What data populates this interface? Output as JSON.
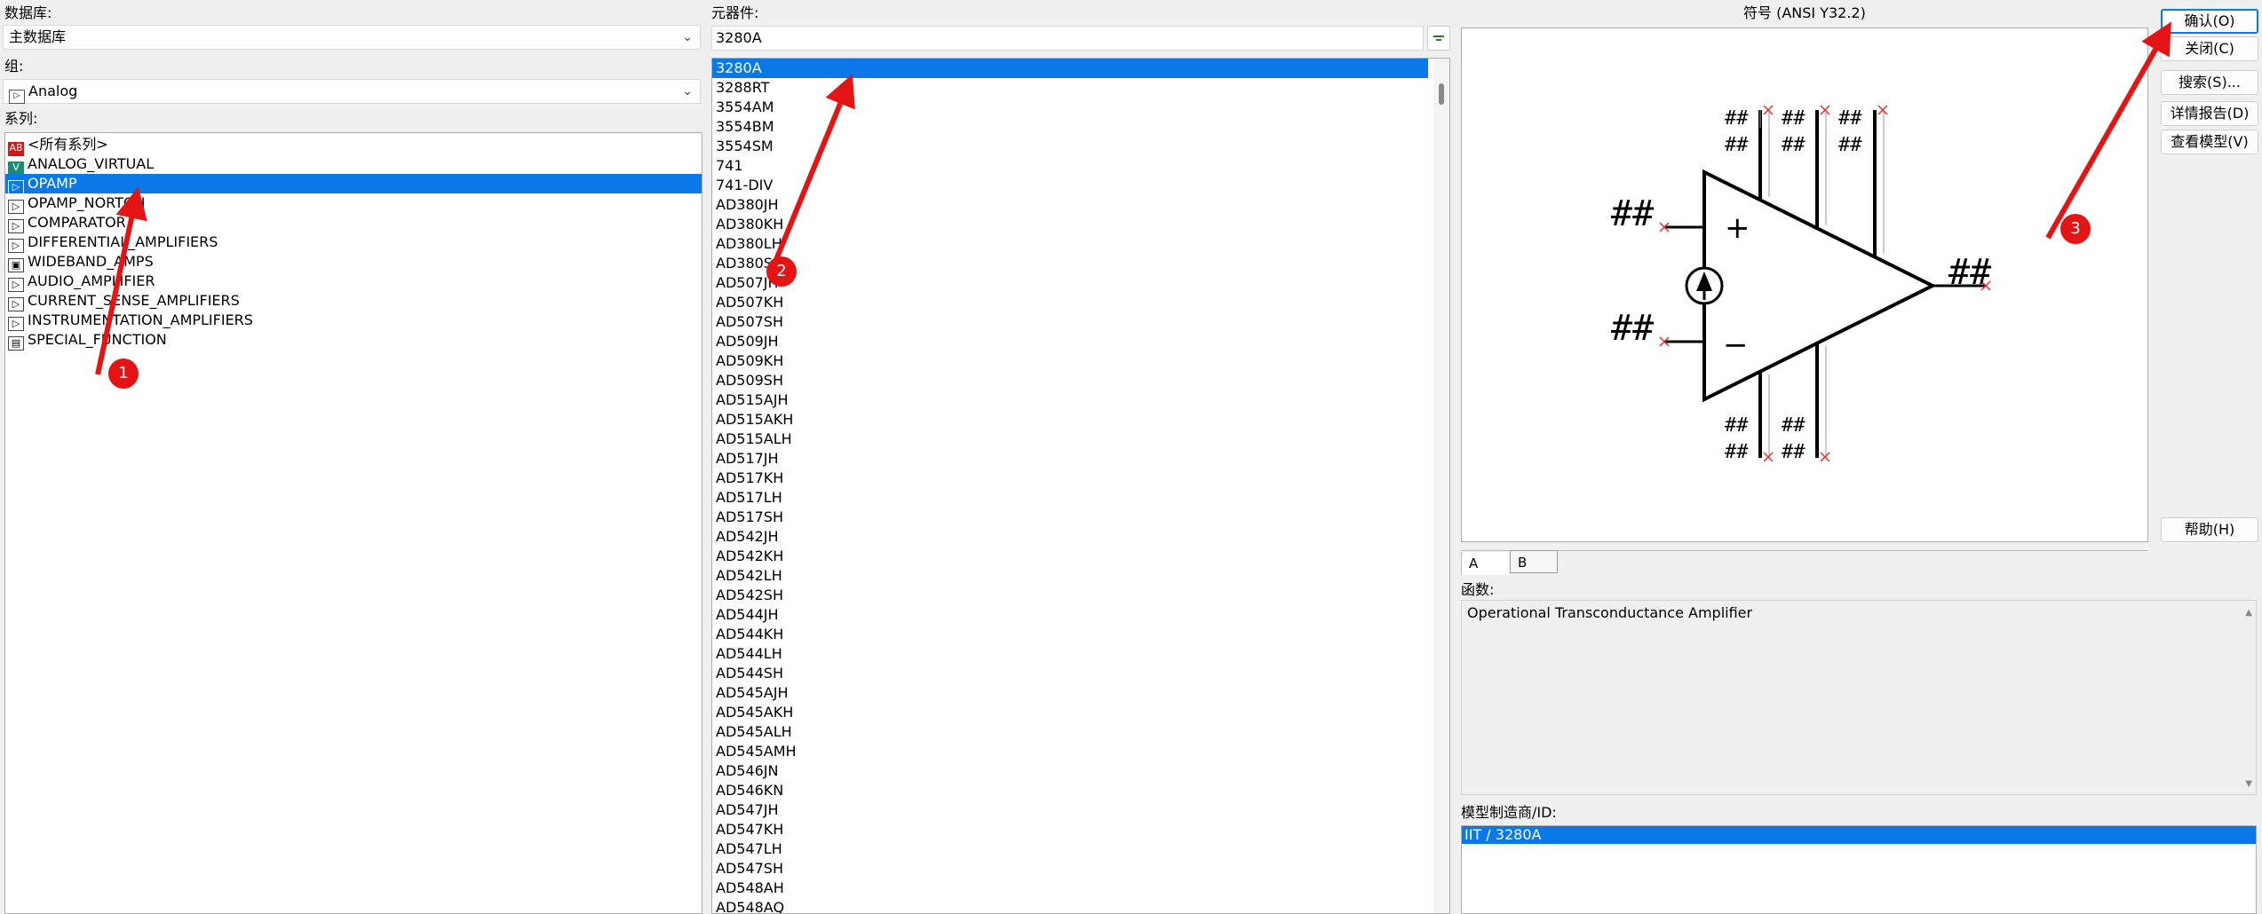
{
  "database": {
    "label": "数据库:",
    "value": "主数据库"
  },
  "group": {
    "label": "组:",
    "value": "Analog"
  },
  "family": {
    "label": "系列:",
    "items": [
      {
        "label": "<所有系列>",
        "icon": "all-families-icon",
        "selected": false
      },
      {
        "label": "ANALOG_VIRTUAL",
        "icon": "virtual-component-icon",
        "selected": false
      },
      {
        "label": "OPAMP",
        "icon": "opamp-icon",
        "selected": true
      },
      {
        "label": "OPAMP_NORTON",
        "icon": "opamp-norton-icon",
        "selected": false
      },
      {
        "label": "COMPARATOR",
        "icon": "comparator-icon",
        "selected": false
      },
      {
        "label": "DIFFERENTIAL_AMPLIFIERS",
        "icon": "differential-amplifier-icon",
        "selected": false
      },
      {
        "label": "WIDEBAND_AMPS",
        "icon": "wideband-amp-icon",
        "selected": false
      },
      {
        "label": "AUDIO_AMPLIFIER",
        "icon": "audio-amplifier-icon",
        "selected": false
      },
      {
        "label": "CURRENT_SENSE_AMPLIFIERS",
        "icon": "current-sense-amplifier-icon",
        "selected": false
      },
      {
        "label": "INSTRUMENTATION_AMPLIFIERS",
        "icon": "instrumentation-amplifier-icon",
        "selected": false
      },
      {
        "label": "SPECIAL_FUNCTION",
        "icon": "special-function-icon",
        "selected": false
      }
    ]
  },
  "component": {
    "label": "元器件:",
    "value": "3280A",
    "items": [
      "3280A",
      "3288RT",
      "3554AM",
      "3554BM",
      "3554SM",
      "741",
      "741-DIV",
      "AD380JH",
      "AD380KH",
      "AD380LH",
      "AD380SH",
      "AD507JH",
      "AD507KH",
      "AD507SH",
      "AD509JH",
      "AD509KH",
      "AD509SH",
      "AD515AJH",
      "AD515AKH",
      "AD515ALH",
      "AD517JH",
      "AD517KH",
      "AD517LH",
      "AD517SH",
      "AD542JH",
      "AD542KH",
      "AD542LH",
      "AD542SH",
      "AD544JH",
      "AD544KH",
      "AD544LH",
      "AD544SH",
      "AD545AJH",
      "AD545AKH",
      "AD545ALH",
      "AD545AMH",
      "AD546JN",
      "AD546KN",
      "AD547JH",
      "AD547KH",
      "AD547LH",
      "AD547SH",
      "AD548AH",
      "AD548AQ"
    ],
    "selected_index": 0
  },
  "symbol": {
    "title": "符号 (ANSI Y32.2)",
    "pin_label": "##",
    "plus_sign": "+",
    "minus_sign": "−",
    "tabs": [
      "A",
      "B"
    ]
  },
  "function": {
    "label": "函数:",
    "value": "Operational Transconductance Amplifier"
  },
  "model": {
    "label": "模型制造商/ID:",
    "items": [
      "IIT / 3280A"
    ]
  },
  "buttons": {
    "ok": "确认(O)",
    "close": "关闭(C)",
    "search": "搜索(S)...",
    "detail_report": "详情报告(D)",
    "view_model": "查看模型(V)",
    "help": "帮助(H)"
  },
  "annotations": {
    "step1": "1",
    "step2": "2",
    "step3": "3",
    "color": "#e51414"
  },
  "colors": {
    "selection": "#0a78e8",
    "background": "#f0f0f0"
  }
}
